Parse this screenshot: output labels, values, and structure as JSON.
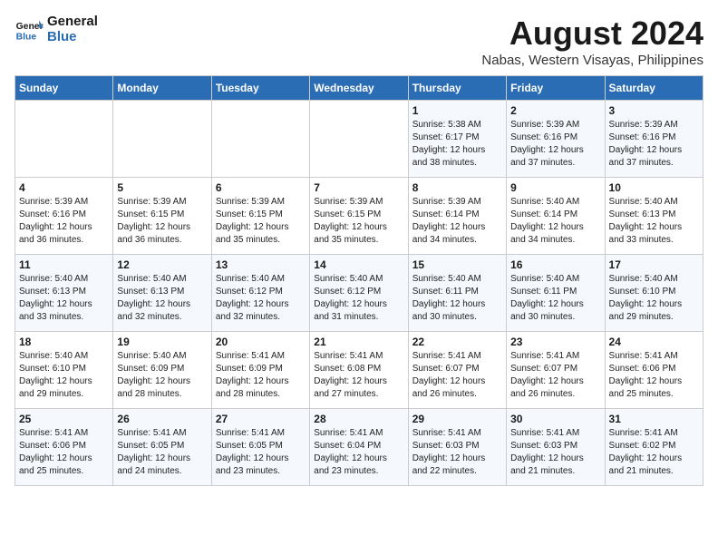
{
  "logo": {
    "line1": "General",
    "line2": "Blue"
  },
  "title": "August 2024",
  "subtitle": "Nabas, Western Visayas, Philippines",
  "days_of_week": [
    "Sunday",
    "Monday",
    "Tuesday",
    "Wednesday",
    "Thursday",
    "Friday",
    "Saturday"
  ],
  "weeks": [
    [
      {
        "day": "",
        "info": ""
      },
      {
        "day": "",
        "info": ""
      },
      {
        "day": "",
        "info": ""
      },
      {
        "day": "",
        "info": ""
      },
      {
        "day": "1",
        "info": "Sunrise: 5:38 AM\nSunset: 6:17 PM\nDaylight: 12 hours\nand 38 minutes."
      },
      {
        "day": "2",
        "info": "Sunrise: 5:39 AM\nSunset: 6:16 PM\nDaylight: 12 hours\nand 37 minutes."
      },
      {
        "day": "3",
        "info": "Sunrise: 5:39 AM\nSunset: 6:16 PM\nDaylight: 12 hours\nand 37 minutes."
      }
    ],
    [
      {
        "day": "4",
        "info": "Sunrise: 5:39 AM\nSunset: 6:16 PM\nDaylight: 12 hours\nand 36 minutes."
      },
      {
        "day": "5",
        "info": "Sunrise: 5:39 AM\nSunset: 6:15 PM\nDaylight: 12 hours\nand 36 minutes."
      },
      {
        "day": "6",
        "info": "Sunrise: 5:39 AM\nSunset: 6:15 PM\nDaylight: 12 hours\nand 35 minutes."
      },
      {
        "day": "7",
        "info": "Sunrise: 5:39 AM\nSunset: 6:15 PM\nDaylight: 12 hours\nand 35 minutes."
      },
      {
        "day": "8",
        "info": "Sunrise: 5:39 AM\nSunset: 6:14 PM\nDaylight: 12 hours\nand 34 minutes."
      },
      {
        "day": "9",
        "info": "Sunrise: 5:40 AM\nSunset: 6:14 PM\nDaylight: 12 hours\nand 34 minutes."
      },
      {
        "day": "10",
        "info": "Sunrise: 5:40 AM\nSunset: 6:13 PM\nDaylight: 12 hours\nand 33 minutes."
      }
    ],
    [
      {
        "day": "11",
        "info": "Sunrise: 5:40 AM\nSunset: 6:13 PM\nDaylight: 12 hours\nand 33 minutes."
      },
      {
        "day": "12",
        "info": "Sunrise: 5:40 AM\nSunset: 6:13 PM\nDaylight: 12 hours\nand 32 minutes."
      },
      {
        "day": "13",
        "info": "Sunrise: 5:40 AM\nSunset: 6:12 PM\nDaylight: 12 hours\nand 32 minutes."
      },
      {
        "day": "14",
        "info": "Sunrise: 5:40 AM\nSunset: 6:12 PM\nDaylight: 12 hours\nand 31 minutes."
      },
      {
        "day": "15",
        "info": "Sunrise: 5:40 AM\nSunset: 6:11 PM\nDaylight: 12 hours\nand 30 minutes."
      },
      {
        "day": "16",
        "info": "Sunrise: 5:40 AM\nSunset: 6:11 PM\nDaylight: 12 hours\nand 30 minutes."
      },
      {
        "day": "17",
        "info": "Sunrise: 5:40 AM\nSunset: 6:10 PM\nDaylight: 12 hours\nand 29 minutes."
      }
    ],
    [
      {
        "day": "18",
        "info": "Sunrise: 5:40 AM\nSunset: 6:10 PM\nDaylight: 12 hours\nand 29 minutes."
      },
      {
        "day": "19",
        "info": "Sunrise: 5:40 AM\nSunset: 6:09 PM\nDaylight: 12 hours\nand 28 minutes."
      },
      {
        "day": "20",
        "info": "Sunrise: 5:41 AM\nSunset: 6:09 PM\nDaylight: 12 hours\nand 28 minutes."
      },
      {
        "day": "21",
        "info": "Sunrise: 5:41 AM\nSunset: 6:08 PM\nDaylight: 12 hours\nand 27 minutes."
      },
      {
        "day": "22",
        "info": "Sunrise: 5:41 AM\nSunset: 6:07 PM\nDaylight: 12 hours\nand 26 minutes."
      },
      {
        "day": "23",
        "info": "Sunrise: 5:41 AM\nSunset: 6:07 PM\nDaylight: 12 hours\nand 26 minutes."
      },
      {
        "day": "24",
        "info": "Sunrise: 5:41 AM\nSunset: 6:06 PM\nDaylight: 12 hours\nand 25 minutes."
      }
    ],
    [
      {
        "day": "25",
        "info": "Sunrise: 5:41 AM\nSunset: 6:06 PM\nDaylight: 12 hours\nand 25 minutes."
      },
      {
        "day": "26",
        "info": "Sunrise: 5:41 AM\nSunset: 6:05 PM\nDaylight: 12 hours\nand 24 minutes."
      },
      {
        "day": "27",
        "info": "Sunrise: 5:41 AM\nSunset: 6:05 PM\nDaylight: 12 hours\nand 23 minutes."
      },
      {
        "day": "28",
        "info": "Sunrise: 5:41 AM\nSunset: 6:04 PM\nDaylight: 12 hours\nand 23 minutes."
      },
      {
        "day": "29",
        "info": "Sunrise: 5:41 AM\nSunset: 6:03 PM\nDaylight: 12 hours\nand 22 minutes."
      },
      {
        "day": "30",
        "info": "Sunrise: 5:41 AM\nSunset: 6:03 PM\nDaylight: 12 hours\nand 21 minutes."
      },
      {
        "day": "31",
        "info": "Sunrise: 5:41 AM\nSunset: 6:02 PM\nDaylight: 12 hours\nand 21 minutes."
      }
    ]
  ]
}
